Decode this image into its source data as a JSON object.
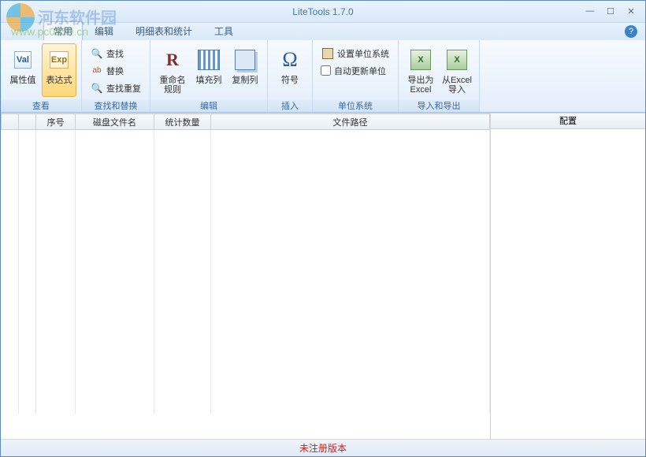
{
  "window": {
    "title": "LiteTools 1.7.0"
  },
  "watermark": {
    "text": "河东软件园",
    "url": "www.pc0359.cn"
  },
  "tabs": {
    "common": "常用",
    "edit": "编辑",
    "detail": "明细表和统计",
    "tools": "工具"
  },
  "ribbon": {
    "view": {
      "label": "查看",
      "attr_value": "属性值",
      "expression": "表达式"
    },
    "find_replace": {
      "label": "查找和替换",
      "find": "查找",
      "replace": "替换",
      "find_dup": "查找重复"
    },
    "edit": {
      "label": "编辑",
      "rename_rule": "重命名\n规则",
      "fill_col": "填充列",
      "copy_col": "复制列"
    },
    "insert": {
      "label": "插入",
      "symbol": "符号"
    },
    "unit": {
      "label": "单位系统",
      "set_unit": "设置单位系统",
      "auto_update": "自动更新单位"
    },
    "io": {
      "label": "导入和导出",
      "export_excel": "导出为\nExcel",
      "import_excel": "从Excel\n导入"
    }
  },
  "columns": {
    "c1": "",
    "c2": "",
    "seq": "序号",
    "filename": "磁盘文件名",
    "count": "统计数量",
    "path": "文件路径"
  },
  "side": {
    "config": "配置"
  },
  "status": {
    "text": "未注册版本"
  }
}
